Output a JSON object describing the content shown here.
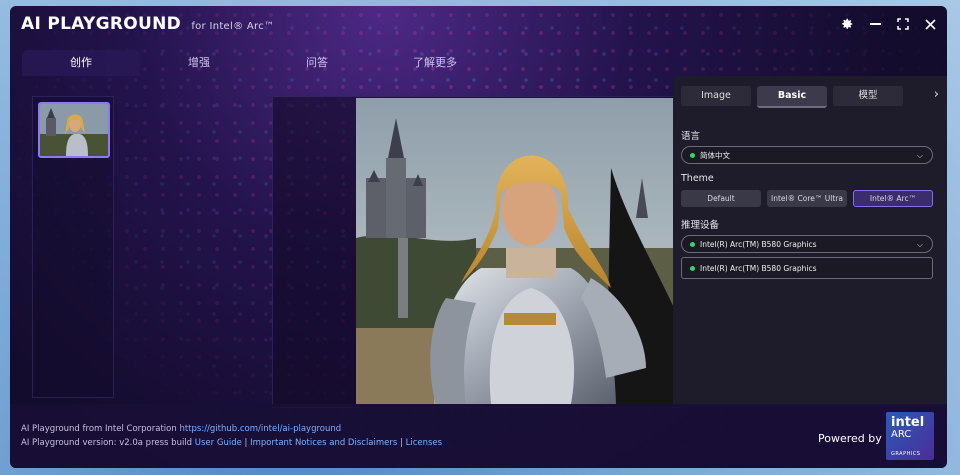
{
  "app": {
    "title_ai": "AI",
    "title_main": "PLAYGROUND",
    "title_sub": "for Intel® Arc™"
  },
  "window_controls": [
    "gear-icon",
    "minimize-icon",
    "maximize-icon",
    "close-icon"
  ],
  "main_tabs": [
    {
      "label": "创作",
      "active": true
    },
    {
      "label": "增强",
      "active": false
    },
    {
      "label": "问答",
      "active": false
    },
    {
      "label": "了解更多",
      "active": false
    }
  ],
  "settings_panel": {
    "tabs": [
      {
        "label": "Image",
        "active": false
      },
      {
        "label": "Basic",
        "active": true
      },
      {
        "label": "模型",
        "active": false
      }
    ],
    "language_label": "语言",
    "language_value": "简体中文",
    "theme_label": "Theme",
    "themes": [
      {
        "label": "Default",
        "active": false
      },
      {
        "label": "Intel® Core™ Ultra",
        "active": false
      },
      {
        "label": "Intel® Arc™",
        "active": true
      }
    ],
    "device_label": "推理设备",
    "device_value": "Intel(R) Arc(TM) B580 Graphics",
    "device_option": "Intel(R) Arc(TM) B580 Graphics"
  },
  "footer": {
    "line1_text": "AI Playground from Intel Corporation ",
    "line1_link": "https://github.com/intel/ai-playground",
    "line2_text": "AI Playground version: v2.0a press build ",
    "link_user_guide": "User Guide",
    "sep1": " | ",
    "link_notices": "Important Notices and Disclaimers",
    "sep2": " | ",
    "link_licenses": "Licenses",
    "powered_by": "Powered by",
    "badge_line1": "intel",
    "badge_line2": "ARC",
    "badge_line3": "GRAPHICS"
  },
  "colors": {
    "accent": "#8a6cf0",
    "status_green": "#2fd36a",
    "link": "#7fb0ff"
  }
}
